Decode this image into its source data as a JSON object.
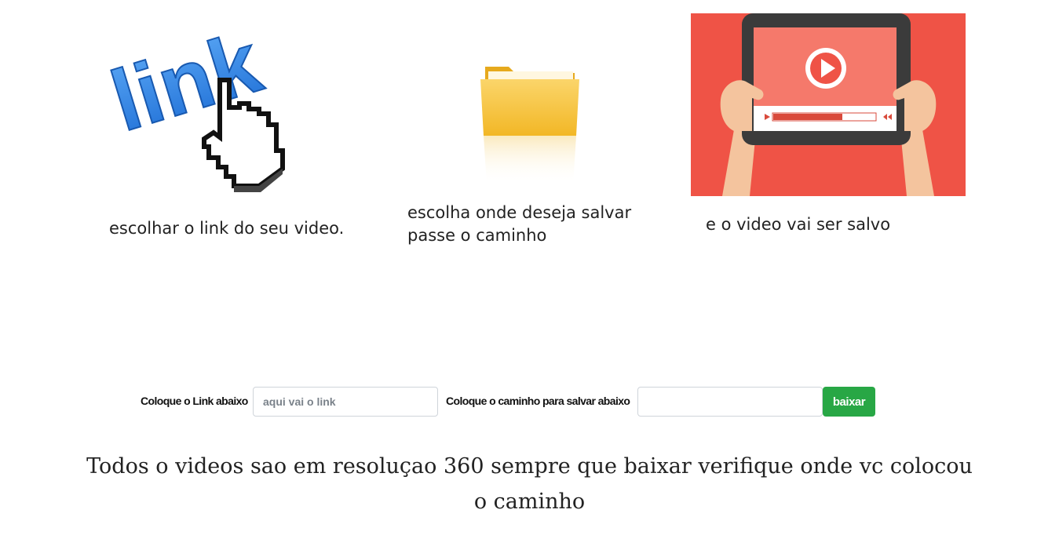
{
  "steps": [
    {
      "image_icon": "link-cursor-icon",
      "image_text": "link",
      "caption": "escolhar o link do seu video."
    },
    {
      "image_icon": "folder-icon",
      "caption_line1": "escolha onde deseja salvar",
      "caption_line2": "passe o caminho"
    },
    {
      "image_icon": "video-player-tablet-icon",
      "caption": "e o video vai ser salvo"
    }
  ],
  "form": {
    "link_label": "Coloque o Link abaixo",
    "link_placeholder": "aqui vai o link",
    "path_label": "Coloque o caminho para salvar abaixo",
    "path_value": "",
    "download_button": "baixar"
  },
  "notice": "Todos o videos sao em resoluçao 360 sempre que baixar verifique onde vc colocou o caminho",
  "colors": {
    "link_blue": "#2a7fe0",
    "folder_yellow": "#f7c64a",
    "video_red": "#ef5346",
    "button_green": "#28a745"
  }
}
